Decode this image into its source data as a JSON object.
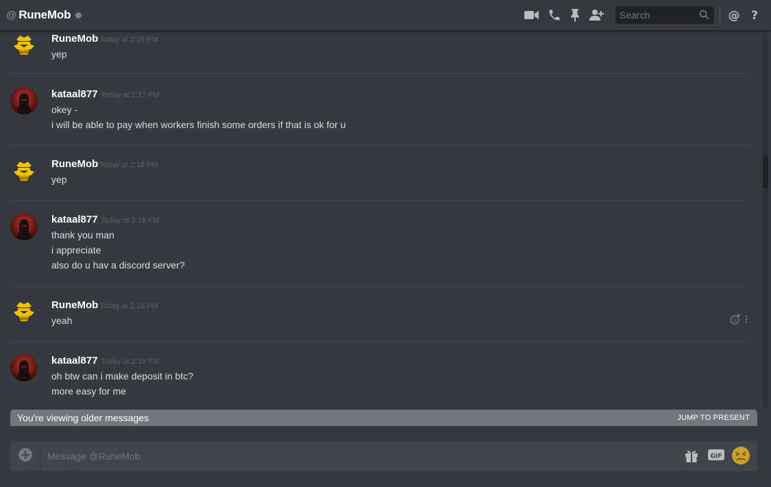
{
  "header": {
    "at": "@",
    "title": "RuneMob",
    "search_placeholder": "Search"
  },
  "icons": {
    "video": "video-call-icon",
    "call": "phone-call-icon",
    "pin": "pin-icon",
    "add_friend": "add-friend-icon",
    "search": "search-icon",
    "mentions": "at-mentions-icon",
    "help": "help-icon",
    "attach": "plus-icon",
    "gift": "gift-icon",
    "gif": "gif-icon",
    "emoji": "emoji-icon"
  },
  "messages": [
    {
      "author": "RuneMob",
      "timestamp": "Today at 2:16 PM",
      "avatar": "runemob",
      "lines": [
        "yep"
      ]
    },
    {
      "author": "kataal877",
      "timestamp": "Today at 2:17 PM",
      "avatar": "kataal",
      "lines": [
        "okey -",
        "i will be able to pay when workers finish some orders if that is ok for u"
      ]
    },
    {
      "author": "RuneMob",
      "timestamp": "Today at 2:18 PM",
      "avatar": "runemob",
      "lines": [
        "yep"
      ]
    },
    {
      "author": "kataal877",
      "timestamp": "Today at 2:18 PM",
      "avatar": "kataal",
      "lines": [
        "thank you man",
        "i appreciate",
        "also do u hav a discord server?"
      ]
    },
    {
      "author": "RuneMob",
      "timestamp": "Today at 2:18 PM",
      "avatar": "runemob",
      "lines": [
        "yeah"
      ]
    },
    {
      "author": "kataal877",
      "timestamp": "Today at 2:19 PM",
      "avatar": "kataal",
      "lines": [
        "oh btw can i make deposit in btc?",
        "more easy for me"
      ]
    }
  ],
  "older_bar": {
    "text": "You're viewing older messages",
    "jump": "JUMP TO PRESENT"
  },
  "composer": {
    "placeholder": "Message @RuneMob",
    "gif_label": "GIF"
  },
  "colors": {
    "background": "#36393f",
    "header_border": "#202225",
    "runemob_avatar": "#f2c200",
    "kataal_avatar": "#8b1a1a",
    "older_bar": "#72767d",
    "composer": "#40444b",
    "emoji": "#c9a227"
  }
}
